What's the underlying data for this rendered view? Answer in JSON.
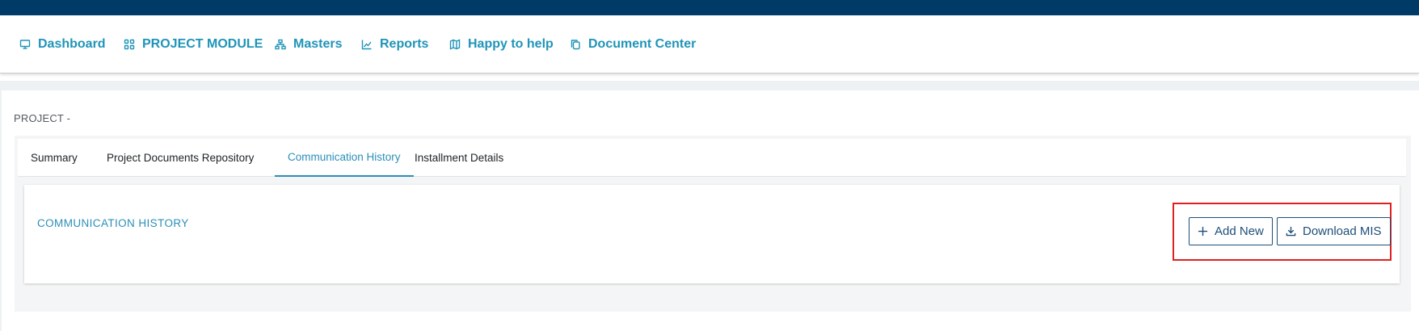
{
  "colors": {
    "topbar": "#003a66",
    "nav_accent": "#1f94b8",
    "tab_active": "#2b8fb8",
    "button_border": "#1f4f7a",
    "highlight": "#e02020"
  },
  "nav": {
    "items": [
      {
        "label": "Dashboard",
        "icon": "monitor-icon"
      },
      {
        "label": "PROJECT MODULE",
        "icon": "grid-icon"
      },
      {
        "label": "Masters",
        "icon": "sitemap-icon"
      },
      {
        "label": "Reports",
        "icon": "chart-line-icon"
      },
      {
        "label": "Happy to help",
        "icon": "map-icon"
      },
      {
        "label": "Document Center",
        "icon": "copy-icon"
      }
    ]
  },
  "page": {
    "project_label": "PROJECT -"
  },
  "tabs": [
    {
      "label": "Summary"
    },
    {
      "label": "Project Documents Repository"
    },
    {
      "label": "Communication History"
    },
    {
      "label": "Installment Details"
    }
  ],
  "card": {
    "title": "COMMUNICATION HISTORY",
    "add_new_label": "Add New",
    "download_label": "Download MIS"
  }
}
